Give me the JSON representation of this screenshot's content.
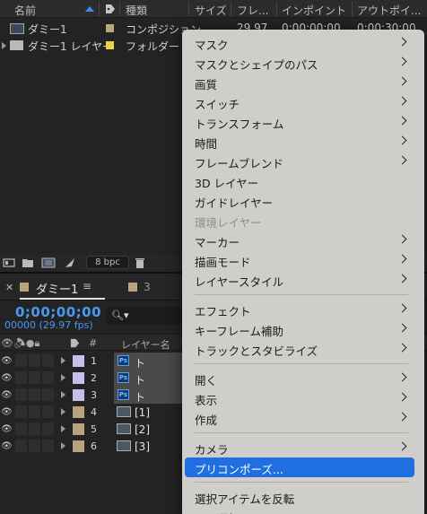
{
  "project": {
    "columns": [
      "名前",
      "種類",
      "サイズ",
      "フレ...",
      "インポイント",
      "アウトポイ..."
    ],
    "rows": [
      {
        "name": "ダミー1",
        "label_color": "#b9a880",
        "type": "コンポジション",
        "size": "",
        "frame": "29.97",
        "in": "0;00;00;00",
        "out": "0;00;30;00"
      },
      {
        "name": "ダミー1 レイヤー",
        "label_color": "#e8d24a",
        "type": "フォルダー",
        "size": "",
        "frame": "",
        "in": "",
        "out": ""
      }
    ],
    "footer": {
      "bpc": "8 bpc"
    }
  },
  "timeline": {
    "tab_label": "ダミー1",
    "tab_menu": "≡",
    "tab2_label": "3",
    "timecode": "0;00;00;00",
    "frames": "00000 (29.97 fps)",
    "search_glyph": "🔍︎▾",
    "col_num": "#",
    "col_name": "レイヤー名",
    "layers": [
      {
        "num": "1",
        "name": "ト",
        "label_color": "#c4c0ea",
        "icon": "photoshop-icon",
        "selected": true
      },
      {
        "num": "2",
        "name": "ト",
        "label_color": "#c4c0ea",
        "icon": "photoshop-icon",
        "selected": true
      },
      {
        "num": "3",
        "name": "ト",
        "label_color": "#c4c0ea",
        "icon": "photoshop-icon",
        "selected": true
      },
      {
        "num": "4",
        "name": "[1]",
        "label_color": "#b7a47e",
        "icon": "composition-icon",
        "selected": false
      },
      {
        "num": "5",
        "name": "[2]",
        "label_color": "#b7a47e",
        "icon": "composition-icon",
        "selected": false
      },
      {
        "num": "6",
        "name": "[3]",
        "label_color": "#b7a47e",
        "icon": "composition-icon",
        "selected": false
      }
    ]
  },
  "menu": {
    "items": [
      {
        "label": "マスク",
        "submenu": true
      },
      {
        "label": "マスクとシェイプのパス",
        "submenu": true
      },
      {
        "label": "画質",
        "submenu": true
      },
      {
        "label": "スイッチ",
        "submenu": true
      },
      {
        "label": "トランスフォーム",
        "submenu": true
      },
      {
        "label": "時間",
        "submenu": true
      },
      {
        "label": "フレームブレンド",
        "submenu": true
      },
      {
        "label": "3D レイヤー",
        "submenu": false
      },
      {
        "label": "ガイドレイヤー",
        "submenu": false
      },
      {
        "label": "環境レイヤー",
        "submenu": false,
        "disabled": true
      },
      {
        "label": "マーカー",
        "submenu": true
      },
      {
        "label": "描画モード",
        "submenu": true
      },
      {
        "label": "レイヤースタイル",
        "submenu": true
      },
      {
        "label": "エフェクト",
        "submenu": true
      },
      {
        "label": "キーフレーム補助",
        "submenu": true
      },
      {
        "label": "トラックとスタビライズ",
        "submenu": true
      },
      {
        "label": "開く",
        "submenu": true
      },
      {
        "label": "表示",
        "submenu": true
      },
      {
        "label": "作成",
        "submenu": true
      },
      {
        "label": "カメラ",
        "submenu": true
      },
      {
        "label": "プリコンポーズ...",
        "submenu": false,
        "highlighted": true
      },
      {
        "label": "選択アイテムを反転",
        "submenu": false
      },
      {
        "label": "子を選択",
        "submenu": false
      }
    ],
    "highlight_color": "#1f6fe0"
  }
}
